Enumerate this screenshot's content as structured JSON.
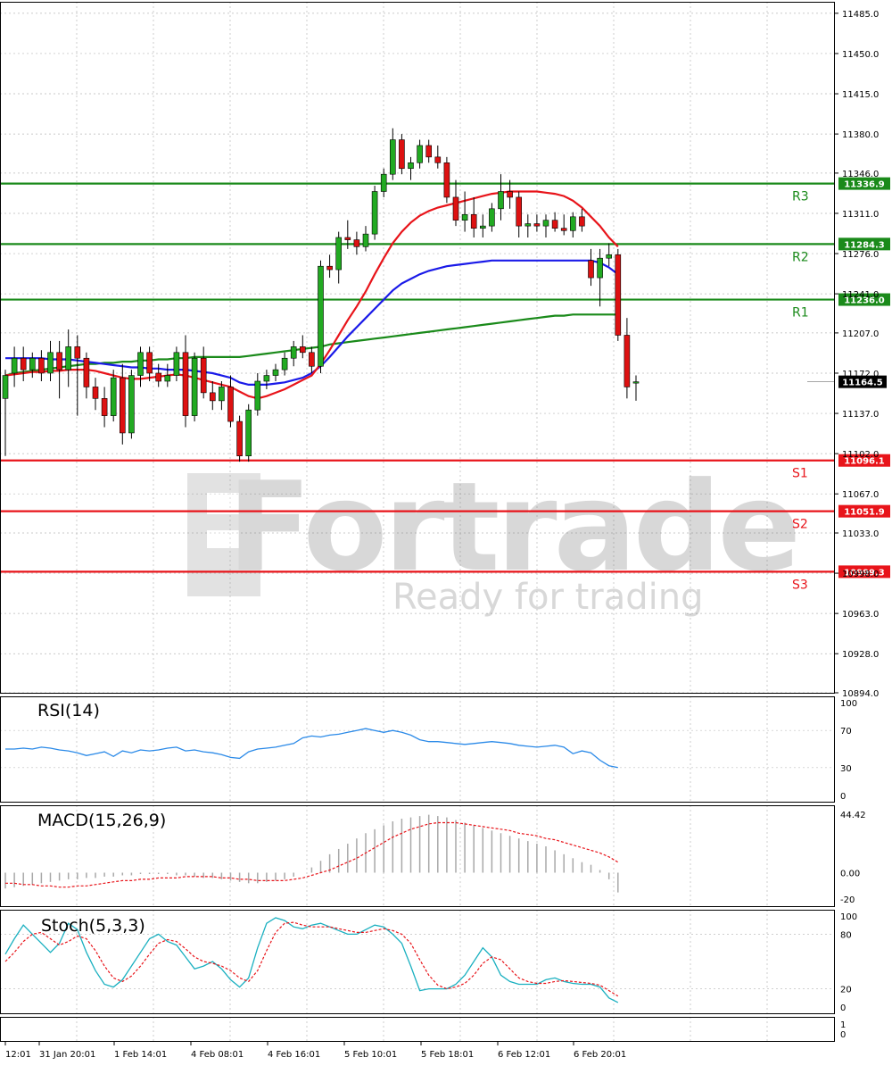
{
  "chart_data": {
    "type": "candlestick",
    "main": {
      "y_ticks": [
        "11485.0",
        "11450.0",
        "11415.0",
        "11380.0",
        "11346.0",
        "11311.0",
        "11276.0",
        "11241.0",
        "11207.0",
        "11172.0",
        "11137.0",
        "11102.0",
        "11067.0",
        "11033.0",
        "10998.0",
        "10963.0",
        "10928.0",
        "10894.0"
      ],
      "ylim": [
        10894,
        11495
      ],
      "current_price": "11164.5",
      "levels": [
        {
          "name": "R3",
          "value": 11336.9,
          "label": "11336.9",
          "color": "#1a8a1a"
        },
        {
          "name": "R2",
          "value": 11284.3,
          "label": "11284.3",
          "color": "#1a8a1a"
        },
        {
          "name": "R1",
          "value": 11236.0,
          "label": "11236.0",
          "color": "#1a8a1a"
        },
        {
          "name": "S1",
          "value": 11096.1,
          "label": "11096.1",
          "color": "#e8141a"
        },
        {
          "name": "S2",
          "value": 11051.9,
          "label": "11051.9",
          "color": "#e8141a"
        },
        {
          "name": "S3",
          "value": 10999.3,
          "label": "10999.3",
          "color": "#e8141a"
        }
      ],
      "candles": [
        [
          11150,
          11175,
          11100,
          11170
        ],
        [
          11172,
          11195,
          11160,
          11185
        ],
        [
          11185,
          11195,
          11165,
          11175
        ],
        [
          11175,
          11190,
          11168,
          11185
        ],
        [
          11185,
          11192,
          11165,
          11172
        ],
        [
          11172,
          11200,
          11165,
          11190
        ],
        [
          11190,
          11200,
          11150,
          11175
        ],
        [
          11175,
          11210,
          11160,
          11195
        ],
        [
          11195,
          11205,
          11135,
          11185
        ],
        [
          11185,
          11190,
          11150,
          11160
        ],
        [
          11160,
          11168,
          11140,
          11150
        ],
        [
          11150,
          11160,
          11125,
          11135
        ],
        [
          11135,
          11175,
          11130,
          11168
        ],
        [
          11168,
          11180,
          11110,
          11120
        ],
        [
          11120,
          11175,
          11115,
          11170
        ],
        [
          11170,
          11195,
          11160,
          11190
        ],
        [
          11190,
          11195,
          11165,
          11172
        ],
        [
          11172,
          11180,
          11160,
          11165
        ],
        [
          11165,
          11180,
          11160,
          11170
        ],
        [
          11170,
          11195,
          11165,
          11190
        ],
        [
          11190,
          11205,
          11125,
          11135
        ],
        [
          11135,
          11190,
          11130,
          11185
        ],
        [
          11185,
          11195,
          11150,
          11155
        ],
        [
          11155,
          11165,
          11140,
          11148
        ],
        [
          11148,
          11165,
          11140,
          11160
        ],
        [
          11160,
          11170,
          11125,
          11130
        ],
        [
          11130,
          11135,
          11095,
          11100
        ],
        [
          11100,
          11145,
          11095,
          11140
        ],
        [
          11140,
          11172,
          11135,
          11165
        ],
        [
          11165,
          11175,
          11158,
          11170
        ],
        [
          11170,
          11180,
          11165,
          11175
        ],
        [
          11175,
          11190,
          11170,
          11185
        ],
        [
          11185,
          11200,
          11178,
          11195
        ],
        [
          11195,
          11205,
          11185,
          11190
        ],
        [
          11190,
          11195,
          11172,
          11178
        ],
        [
          11178,
          11270,
          11172,
          11265
        ],
        [
          11265,
          11275,
          11255,
          11262
        ],
        [
          11262,
          11295,
          11250,
          11290
        ],
        [
          11290,
          11305,
          11280,
          11288
        ],
        [
          11288,
          11295,
          11275,
          11282
        ],
        [
          11282,
          11300,
          11278,
          11293
        ],
        [
          11293,
          11335,
          11288,
          11330
        ],
        [
          11330,
          11350,
          11325,
          11345
        ],
        [
          11345,
          11385,
          11340,
          11375
        ],
        [
          11375,
          11380,
          11345,
          11350
        ],
        [
          11350,
          11360,
          11340,
          11355
        ],
        [
          11355,
          11375,
          11350,
          11370
        ],
        [
          11370,
          11375,
          11355,
          11360
        ],
        [
          11360,
          11370,
          11350,
          11355
        ],
        [
          11355,
          11360,
          11320,
          11325
        ],
        [
          11325,
          11340,
          11300,
          11305
        ],
        [
          11305,
          11330,
          11295,
          11310
        ],
        [
          11310,
          11325,
          11290,
          11298
        ],
        [
          11298,
          11310,
          11290,
          11300
        ],
        [
          11300,
          11320,
          11295,
          11315
        ],
        [
          11315,
          11345,
          11305,
          11330
        ],
        [
          11330,
          11340,
          11315,
          11325
        ],
        [
          11325,
          11330,
          11290,
          11300
        ],
        [
          11300,
          11310,
          11290,
          11302
        ],
        [
          11302,
          11310,
          11295,
          11300
        ],
        [
          11300,
          11310,
          11290,
          11305
        ],
        [
          11305,
          11312,
          11295,
          11298
        ],
        [
          11298,
          11310,
          11292,
          11296
        ],
        [
          11296,
          11312,
          11290,
          11308
        ],
        [
          11308,
          11315,
          11295,
          11300
        ],
        [
          11270,
          11280,
          11248,
          11255
        ],
        [
          11255,
          11280,
          11230,
          11272
        ],
        [
          11272,
          11285,
          11265,
          11275
        ],
        [
          11275,
          11280,
          11200,
          11205
        ],
        [
          11205,
          11220,
          11150,
          11160
        ],
        [
          11164,
          11170,
          11148,
          11164.5
        ]
      ],
      "ma_red": [
        11170,
        11171,
        11172,
        11173,
        11173,
        11174,
        11174,
        11175,
        11175,
        11175,
        11174,
        11172,
        11170,
        11168,
        11167,
        11167,
        11168,
        11169,
        11170,
        11171,
        11170,
        11168,
        11166,
        11164,
        11162,
        11160,
        11156,
        11152,
        11150,
        11152,
        11155,
        11158,
        11162,
        11166,
        11170,
        11180,
        11192,
        11205,
        11218,
        11230,
        11243,
        11258,
        11272,
        11285,
        11295,
        11303,
        11309,
        11313,
        11316,
        11318,
        11320,
        11322,
        11324,
        11326,
        11328,
        11329,
        11330,
        11330,
        11330,
        11330,
        11329,
        11328,
        11326,
        11322,
        11316,
        11308,
        11300,
        11290,
        11282
      ],
      "ma_blue": [
        11185,
        11185,
        11185,
        11185,
        11185,
        11184,
        11184,
        11184,
        11183,
        11182,
        11181,
        11180,
        11179,
        11178,
        11177,
        11177,
        11176,
        11176,
        11175,
        11175,
        11175,
        11174,
        11173,
        11172,
        11170,
        11168,
        11164,
        11162,
        11162,
        11162,
        11163,
        11164,
        11166,
        11168,
        11172,
        11178,
        11186,
        11195,
        11204,
        11212,
        11220,
        11228,
        11236,
        11244,
        11250,
        11254,
        11258,
        11261,
        11263,
        11265,
        11266,
        11267,
        11268,
        11269,
        11270,
        11270,
        11270,
        11270,
        11270,
        11270,
        11270,
        11270,
        11270,
        11270,
        11270,
        11270,
        11268,
        11264,
        11258
      ],
      "ma_green": [
        11170,
        11172,
        11173,
        11174,
        11175,
        11176,
        11177,
        11178,
        11179,
        11180,
        11180,
        11181,
        11181,
        11182,
        11182,
        11183,
        11183,
        11184,
        11184,
        11185,
        11185,
        11186,
        11186,
        11186,
        11186,
        11186,
        11186,
        11187,
        11188,
        11189,
        11190,
        11191,
        11192,
        11193,
        11194,
        11195,
        11197,
        11198,
        11199,
        11200,
        11201,
        11202,
        11203,
        11204,
        11205,
        11206,
        11207,
        11208,
        11209,
        11210,
        11211,
        11212,
        11213,
        11214,
        11215,
        11216,
        11217,
        11218,
        11219,
        11220,
        11221,
        11222,
        11222,
        11223,
        11223,
        11223,
        11223,
        11223,
        11223
      ]
    },
    "x_labels": [
      "12:01",
      "31 Jan 20:01",
      "1 Feb 14:01",
      "4 Feb 08:01",
      "4 Feb 16:01",
      "5 Feb 10:01",
      "5 Feb 18:01",
      "6 Feb 12:01",
      "6 Feb 20:01"
    ],
    "rsi": {
      "title": "RSI(14)",
      "ticks": [
        "100",
        "70",
        "30",
        "0"
      ],
      "values": [
        50,
        50,
        51,
        50,
        52,
        51,
        49,
        48,
        46,
        43,
        45,
        47,
        42,
        48,
        46,
        49,
        48,
        49,
        51,
        52,
        48,
        49,
        47,
        46,
        44,
        41,
        40,
        47,
        50,
        51,
        52,
        54,
        56,
        62,
        64,
        63,
        65,
        66,
        68,
        70,
        72,
        70,
        68,
        70,
        68,
        65,
        60,
        58,
        58,
        57,
        56,
        55,
        56,
        57,
        58,
        57,
        56,
        54,
        53,
        52,
        53,
        54,
        52,
        45,
        48,
        46,
        38,
        32,
        30
      ]
    },
    "macd": {
      "title": "MACD(15,26,9)",
      "ticks": [
        "44.42",
        "0.00",
        "-20"
      ],
      "hist": [
        -12,
        -11,
        -10,
        -9,
        -8,
        -7,
        -6,
        -5,
        -5,
        -4,
        -4,
        -3,
        -3,
        -2,
        -2,
        -1,
        -1,
        -1,
        -1,
        -2,
        -2,
        -3,
        -4,
        -4,
        -5,
        -6,
        -7,
        -8,
        -8,
        -7,
        -6,
        -5,
        -3,
        0,
        4,
        9,
        14,
        18,
        22,
        26,
        30,
        33,
        36,
        39,
        41,
        42,
        43,
        44,
        43,
        42,
        40,
        38,
        36,
        34,
        32,
        30,
        28,
        26,
        24,
        22,
        20,
        17,
        14,
        11,
        8,
        6,
        2,
        -5,
        -15
      ],
      "signal": [
        -8,
        -8,
        -9,
        -9,
        -10,
        -10,
        -11,
        -11,
        -10,
        -10,
        -9,
        -8,
        -7,
        -6,
        -6,
        -5,
        -5,
        -4,
        -4,
        -4,
        -3,
        -3,
        -3,
        -3,
        -4,
        -4,
        -5,
        -5,
        -6,
        -6,
        -6,
        -6,
        -5,
        -4,
        -2,
        0,
        2,
        5,
        8,
        11,
        15,
        19,
        23,
        27,
        30,
        33,
        35,
        37,
        38,
        38,
        38,
        37,
        36,
        35,
        34,
        33,
        32,
        30,
        29,
        28,
        26,
        25,
        23,
        21,
        19,
        17,
        15,
        12,
        8
      ]
    },
    "stoch": {
      "title": "Stoch(5,3,3)",
      "ticks": [
        "100",
        "80",
        "20",
        "0"
      ],
      "k": [
        58,
        75,
        90,
        80,
        70,
        60,
        70,
        92,
        85,
        60,
        40,
        25,
        22,
        30,
        45,
        60,
        75,
        80,
        72,
        68,
        55,
        42,
        45,
        50,
        42,
        30,
        22,
        32,
        65,
        92,
        98,
        95,
        88,
        86,
        90,
        92,
        88,
        84,
        80,
        80,
        85,
        90,
        88,
        80,
        70,
        45,
        18,
        20,
        20,
        20,
        25,
        35,
        50,
        65,
        55,
        35,
        28,
        25,
        25,
        25,
        30,
        32,
        28,
        26,
        25,
        25,
        22,
        10,
        5
      ],
      "d": [
        50,
        60,
        72,
        80,
        82,
        75,
        68,
        72,
        78,
        75,
        62,
        45,
        32,
        28,
        34,
        45,
        58,
        70,
        74,
        72,
        64,
        55,
        50,
        48,
        45,
        40,
        32,
        28,
        40,
        62,
        82,
        92,
        93,
        90,
        88,
        88,
        88,
        86,
        84,
        82,
        82,
        84,
        86,
        84,
        80,
        70,
        52,
        35,
        24,
        20,
        22,
        26,
        35,
        48,
        55,
        52,
        42,
        32,
        28,
        26,
        26,
        28,
        29,
        28,
        27,
        26,
        24,
        18,
        12
      ]
    }
  }
}
